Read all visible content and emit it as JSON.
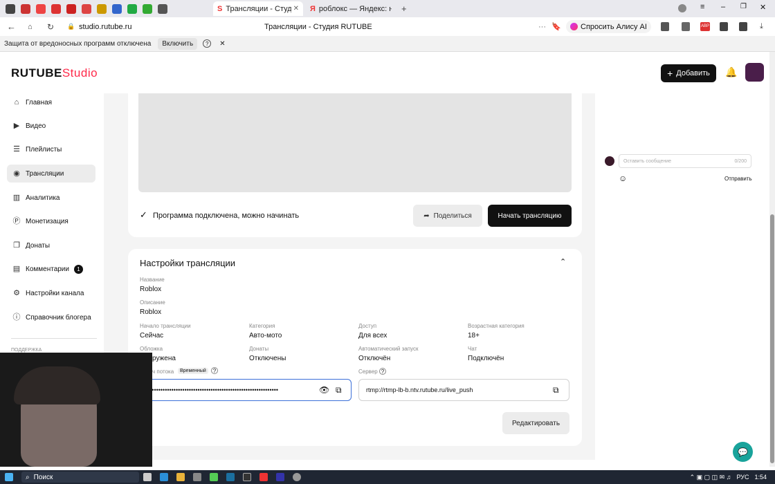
{
  "browser": {
    "tabs": [
      {
        "title": "Трансляции - Студия R",
        "active": true
      },
      {
        "title": "роблокс — Яндекс: нашл",
        "active": false
      }
    ],
    "url": "studio.rutube.ru",
    "page_title": "Трансляции - Студия RUTUBE",
    "alice_label": "Спросить Алису AI",
    "infobar_text": "Защита от вредоносных программ отключена",
    "infobar_button": "Включить"
  },
  "header": {
    "logo_main": "RUTUBE",
    "logo_studio": "Studio",
    "add_button": "Добавить"
  },
  "sidebar": {
    "items": [
      {
        "label": "Главная",
        "icon": "home-icon"
      },
      {
        "label": "Видео",
        "icon": "video-icon"
      },
      {
        "label": "Плейлисты",
        "icon": "playlist-icon"
      },
      {
        "label": "Трансляции",
        "icon": "broadcast-icon",
        "active": true
      },
      {
        "label": "Аналитика",
        "icon": "analytics-icon"
      },
      {
        "label": "Монетизация",
        "icon": "monetization-icon"
      },
      {
        "label": "Донаты",
        "icon": "donations-icon"
      },
      {
        "label": "Комментарии",
        "icon": "comments-icon",
        "badge": "1"
      },
      {
        "label": "Настройки канала",
        "icon": "settings-icon"
      },
      {
        "label": "Справочник блогера",
        "icon": "info-icon"
      }
    ],
    "footer_label": "ПОДДЕРЖКА"
  },
  "stream": {
    "status_text": "Программа подключена, можно начинать",
    "share_button": "Поделиться",
    "start_button": "Начать трансляцию"
  },
  "settings": {
    "title": "Настройки трансляции",
    "name_label": "Название",
    "name_value": "Roblox",
    "desc_label": "Описание",
    "desc_value": "Roblox",
    "start_label": "Начало трансляции",
    "start_value": "Сейчас",
    "category_label": "Категория",
    "category_value": "Авто-мото",
    "access_label": "Доступ",
    "access_value": "Для всех",
    "age_label": "Возрастная категория",
    "age_value": "18+",
    "cover_label": "Обложка",
    "cover_value": "ружена",
    "donations_label": "Донаты",
    "donations_value": "Отключены",
    "autostart_label": "Автоматический запуск",
    "autostart_value": "Отключён",
    "chat_label": "Чат",
    "chat_value": "Подключён",
    "key_label": "ч потока",
    "key_badge": "Временный",
    "key_value": "••••••••••••••••••••••••••••••••••••••••••••••••••••••••••••",
    "server_label": "Сервер",
    "server_value": "rtmp://rtmp-lb-b.ntv.rutube.ru/live_push",
    "edit_button": "Редактировать"
  },
  "chat": {
    "placeholder": "Оставить сообщение",
    "counter": "0/200",
    "send_button": "Отправить"
  },
  "taskbar": {
    "search_label": "Поиск",
    "lang": "РУС",
    "time": "1:54"
  }
}
